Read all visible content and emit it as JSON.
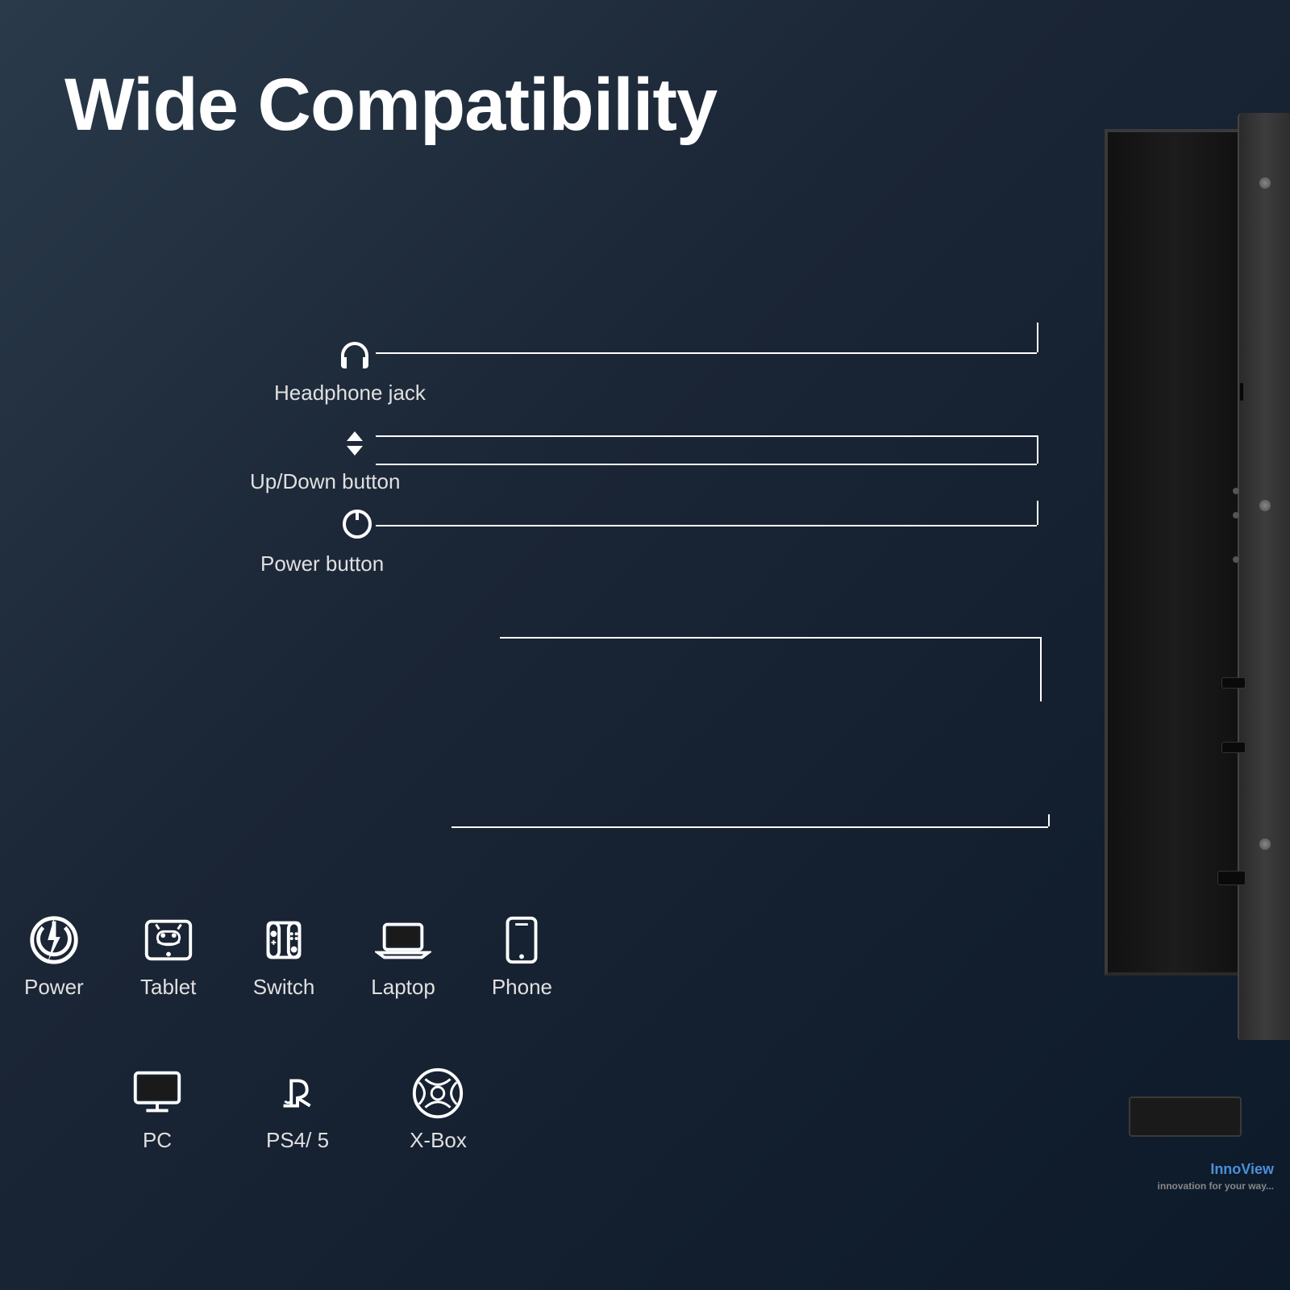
{
  "page": {
    "title": "Wide Compatibility",
    "background": {
      "gradient_start": "#2a3a4a",
      "gradient_mid": "#1a2535",
      "gradient_end": "#0d1a2a"
    }
  },
  "diagram": {
    "headphone_label": "Headphone jack",
    "updown_label": "Up/Down button",
    "power_label": "Power button"
  },
  "compatibility": {
    "row1": [
      {
        "id": "power",
        "label": "Power"
      },
      {
        "id": "tablet",
        "label": "Tablet"
      },
      {
        "id": "switch",
        "label": "Switch"
      },
      {
        "id": "laptop",
        "label": "Laptop"
      },
      {
        "id": "phone",
        "label": "Phone"
      }
    ],
    "row2": [
      {
        "id": "pc",
        "label": "PC"
      },
      {
        "id": "ps45",
        "label": "PS4/ 5"
      },
      {
        "id": "xbox",
        "label": "X-Box"
      }
    ]
  },
  "branding": {
    "name": "InnoView",
    "tagline": "innovation for your way..."
  }
}
